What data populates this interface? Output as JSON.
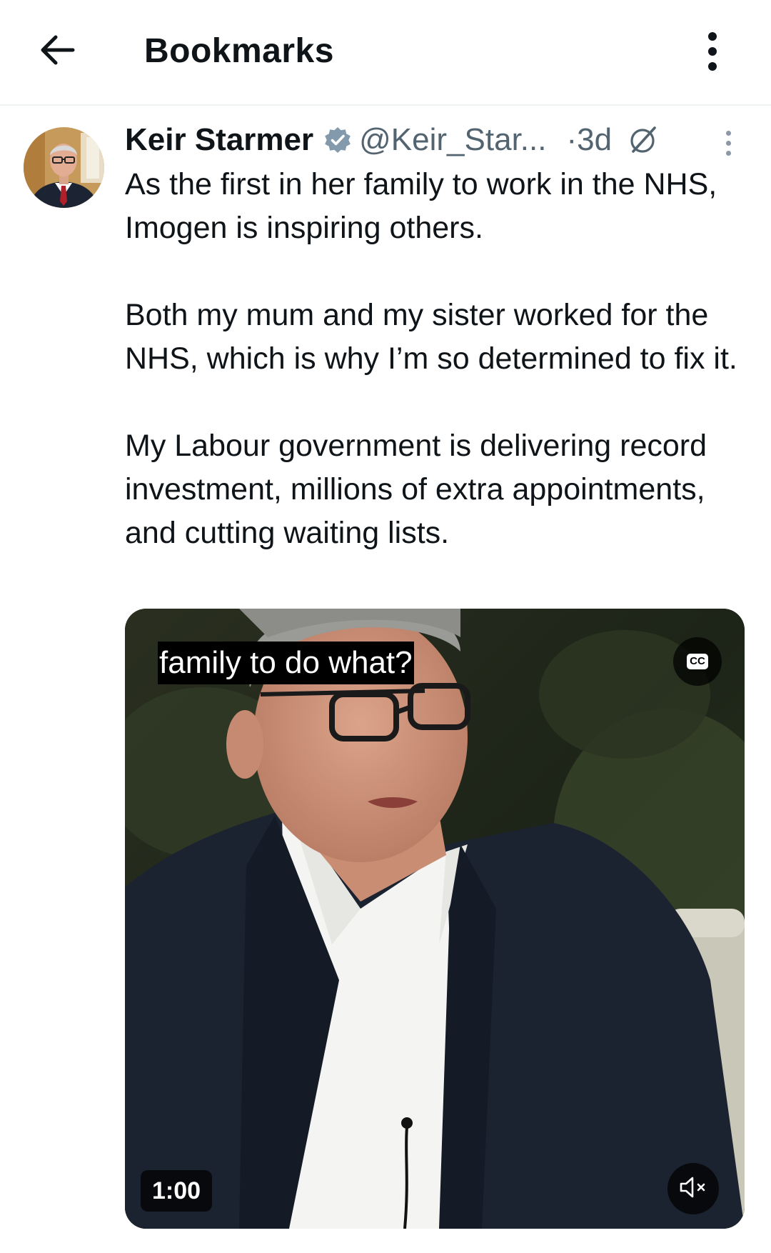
{
  "header": {
    "title": "Bookmarks",
    "back_icon": "arrow-left-icon",
    "more_icon": "more-vertical-icon"
  },
  "tweet": {
    "author_name": "Keir Starmer",
    "handle": "@Keir_Star...",
    "time": "·3d",
    "verified": true,
    "text": [
      "As the first in her family to work in the NHS, Imogen is inspiring others.",
      "Both my mum and my sister worked for the NHS, which is why I’m so determined to fix it.",
      "My Labour government is delivering record investment, millions of extra appointments, and cutting waiting lists."
    ],
    "video": {
      "caption": "family to do what?",
      "cc_label": "CC",
      "duration": "1:00",
      "muted": true
    }
  },
  "colors": {
    "text_primary": "#0f1419",
    "text_secondary": "#536471",
    "verified_badge": "#829aab",
    "divider": "#eff3f4"
  }
}
